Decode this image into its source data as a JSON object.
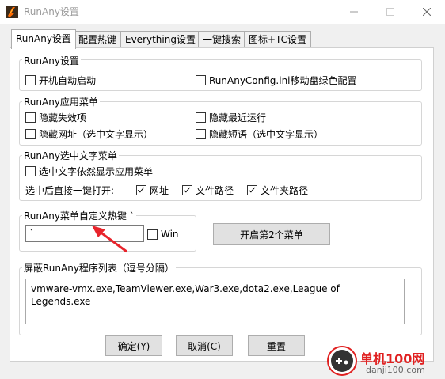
{
  "window": {
    "title": "RunAny设置"
  },
  "tabs": [
    {
      "label": "RunAny设置",
      "active": true
    },
    {
      "label": "配置热键",
      "active": false
    },
    {
      "label": "Everything设置",
      "active": false
    },
    {
      "label": "一键搜索",
      "active": false
    },
    {
      "label": "图标+TC设置",
      "active": false
    }
  ],
  "runany_settings": {
    "title": "RunAny设置",
    "autostart_label": "开机自动启动",
    "autostart_checked": false,
    "portable_label": "RunAnyConfig.ini移动盘绿色配置",
    "portable_checked": false
  },
  "app_menu": {
    "title": "RunAny应用菜单",
    "hide_invalid_label": "隐藏失效项",
    "hide_recent_label": "隐藏最近运行",
    "hide_url_label": "隐藏网址（选中文字显示）",
    "hide_phrase_label": "隐藏短语（选中文字显示）"
  },
  "text_menu": {
    "title": "RunAny选中文字菜单",
    "show_app_label": "选中文字依然显示应用菜单",
    "direct_open_label": "选中后直接一键打开:",
    "url_label": "网址",
    "file_path_label": "文件路径",
    "folder_path_label": "文件夹路径"
  },
  "hotkey": {
    "title": "RunAny菜单自定义热键 `",
    "value": "`",
    "win_label": "Win",
    "second_menu_button": "开启第2个菜单"
  },
  "blacklist": {
    "title": "屏蔽RunAny程序列表（逗号分隔）",
    "value": "vmware-vmx.exe,TeamViewer.exe,War3.exe,dota2.exe,League of Legends.exe"
  },
  "buttons": {
    "ok": "确定(Y)",
    "cancel": "取消(C)",
    "reset": "重置"
  },
  "watermark": {
    "name": "单机100网",
    "url": "danji100.com"
  },
  "colors": {
    "arrow": "#e8232b",
    "brand_red": "#e02020",
    "accent": "#0078d7"
  }
}
